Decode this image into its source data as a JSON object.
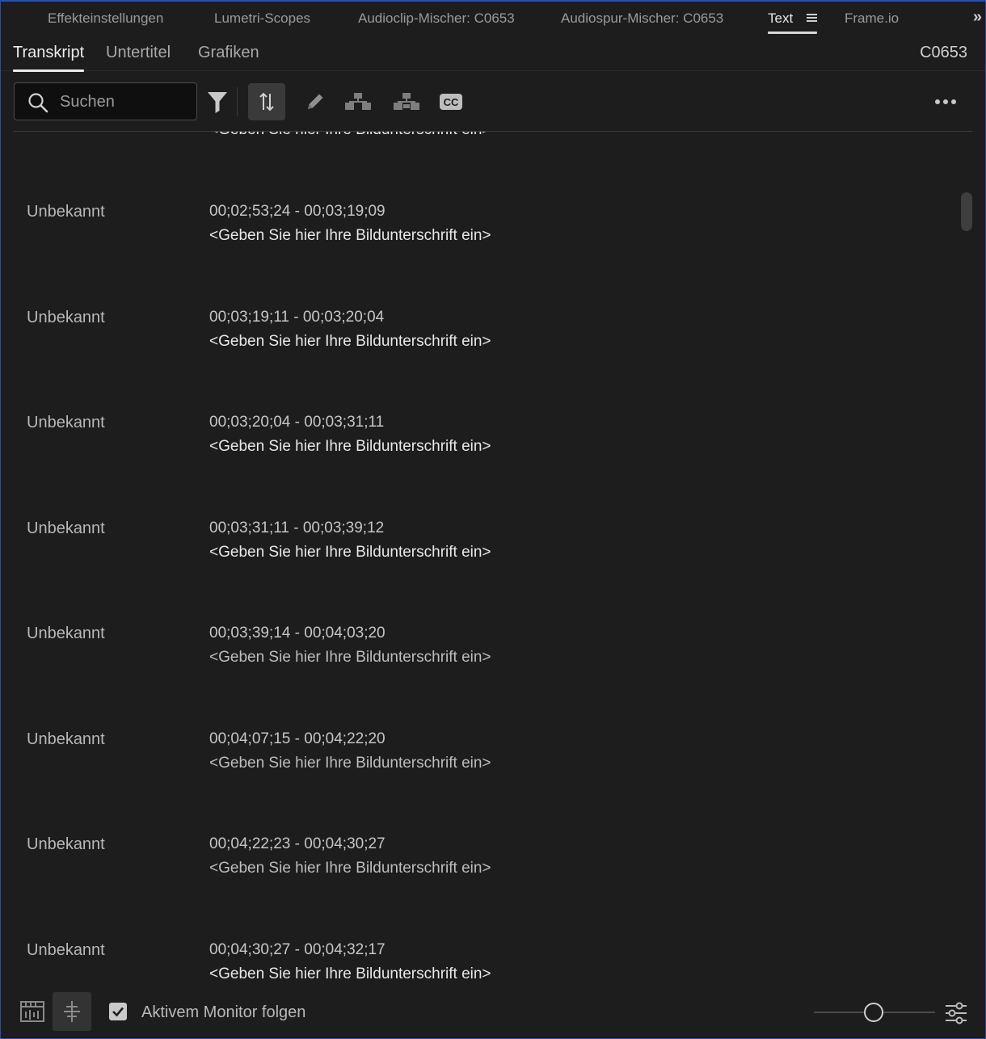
{
  "panel_tabs": [
    {
      "label": "Effekteinstellungen"
    },
    {
      "label": "Lumetri-Scopes"
    },
    {
      "label": "Audioclip-Mischer: C0653"
    },
    {
      "label": "Audiospur-Mischer: C0653"
    },
    {
      "label": "Text"
    },
    {
      "label": "Frame.io"
    }
  ],
  "active_panel_tab": "Text",
  "overflow_glyph": "»",
  "sub_tabs": [
    {
      "label": "Transkript"
    },
    {
      "label": "Untertitel"
    },
    {
      "label": "Grafiken"
    }
  ],
  "active_sub_tab": "Transkript",
  "clip_name": "C0653",
  "search": {
    "placeholder": "Suchen",
    "value": ""
  },
  "partial_row": {
    "caption": "<Geben Sie hier Ihre Bildunterschrift ein>"
  },
  "rows": [
    {
      "speaker": "Unbekannt",
      "timecode": "00;02;53;24 - 00;03;19;09",
      "caption": "<Geben Sie hier Ihre Bildunterschrift ein>"
    },
    {
      "speaker": "Unbekannt",
      "timecode": "00;03;19;11 - 00;03;20;04",
      "caption": "<Geben Sie hier Ihre Bildunterschrift ein>"
    },
    {
      "speaker": "Unbekannt",
      "timecode": "00;03;20;04 - 00;03;31;11",
      "caption": "<Geben Sie hier Ihre Bildunterschrift ein>"
    },
    {
      "speaker": "Unbekannt",
      "timecode": "00;03;31;11 - 00;03;39;12",
      "caption": "<Geben Sie hier Ihre Bildunterschrift ein>"
    },
    {
      "speaker": "Unbekannt",
      "timecode": "00;03;39;14 - 00;04;03;20",
      "caption": "<Geben Sie hier Ihre Bildunterschrift ein>"
    },
    {
      "speaker": "Unbekannt",
      "timecode": "00;04;07;15 - 00;04;22;20",
      "caption": "<Geben Sie hier Ihre Bildunterschrift ein>"
    },
    {
      "speaker": "Unbekannt",
      "timecode": "00;04;22;23 - 00;04;30;27",
      "caption": "<Geben Sie hier Ihre Bildunterschrift ein>"
    },
    {
      "speaker": "Unbekannt",
      "timecode": "00;04;30;27 - 00;04;32;17",
      "caption": "<Geben Sie hier Ihre Bildunterschrift ein>"
    }
  ],
  "footer": {
    "follow_monitor_label": "Aktivem Monitor folgen",
    "follow_monitor_checked": true
  },
  "colors": {
    "background": "#1d1d1d",
    "accent_border": "#2d4f9e",
    "active_button": "#3a3a3a"
  }
}
